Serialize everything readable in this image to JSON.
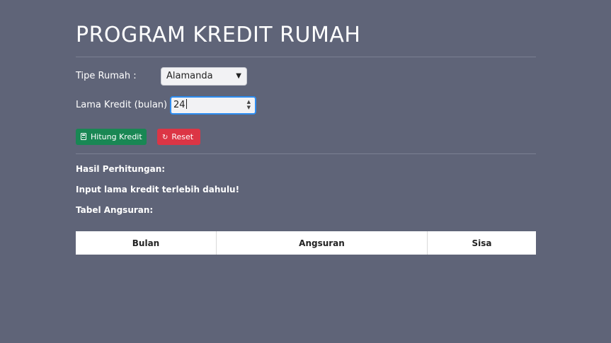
{
  "title": "PROGRAM KREDIT RUMAH",
  "form": {
    "tipe_rumah_label": "Tipe Rumah :",
    "tipe_rumah_value": "Alamanda",
    "lama_kredit_label": "Lama Kredit (bulan) :",
    "lama_kredit_value": "24"
  },
  "buttons": {
    "hitung_label": "Hitung Kredit",
    "reset_label": "Reset"
  },
  "result": {
    "heading": "Hasil Perhitungan:",
    "message": "Input lama kredit terlebih dahulu!",
    "table_heading": "Tabel Angsuran:"
  },
  "table": {
    "columns": [
      "Bulan",
      "Angsuran",
      "Sisa"
    ]
  },
  "colors": {
    "background": "#5f6478",
    "hitung_button": "#198754",
    "reset_button": "#dc3545",
    "input_focus_border": "#2d8cf0"
  }
}
